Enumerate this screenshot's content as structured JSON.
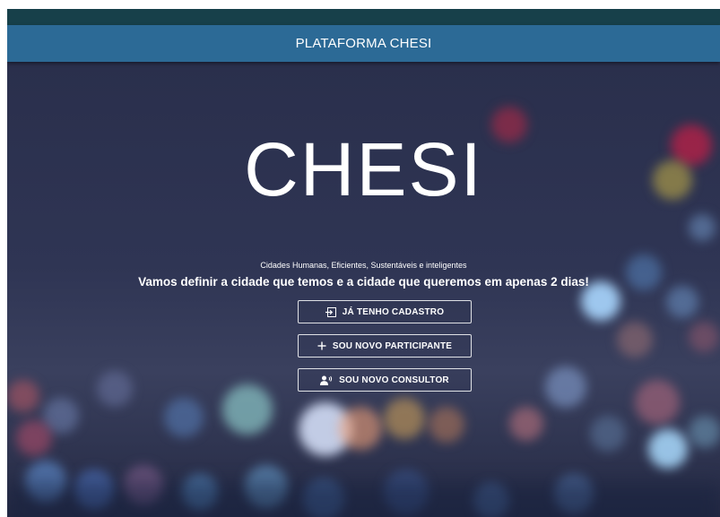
{
  "app": {
    "header_title": "PLATAFORMA CHESI"
  },
  "hero": {
    "title": "CHESI",
    "subtitle": "Cidades Humanas, Eficientes, Sustentáveis e inteligentes",
    "tagline": "Vamos definir a cidade que temos e a cidade que queremos em apenas 2 dias!"
  },
  "buttons": {
    "login_label": "JÁ TENHO CADASTRO",
    "login_icon": "login-icon",
    "new_participant_label": "SOU NOVO PARTICIPANTE",
    "new_participant_icon": "plus-icon",
    "new_consultant_label": "SOU NOVO CONSULTOR",
    "new_consultant_icon": "person-voice-icon"
  },
  "colors": {
    "header_bg": "#2c6a96",
    "top_strip": "#17404a",
    "hero_bg": "#2d3250",
    "text": "#ffffff"
  }
}
